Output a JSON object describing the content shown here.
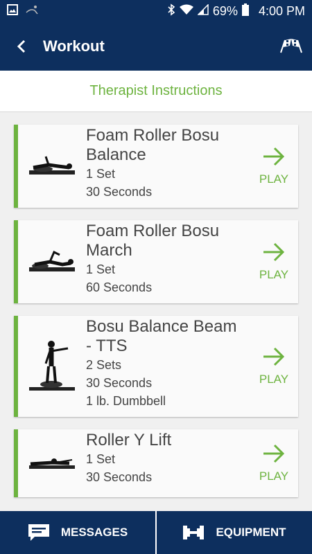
{
  "status_bar": {
    "battery": "69%",
    "time": "4:00 PM"
  },
  "app_bar": {
    "title": "Workout"
  },
  "instructions": {
    "label": "Therapist Instructions"
  },
  "exercises": [
    {
      "title_lines": [
        "Foam Roller Bosu",
        "Balance"
      ],
      "details": [
        "1 Set",
        "30 Seconds"
      ],
      "play_label": "PLAY"
    },
    {
      "title_lines": [
        "Foam Roller Bosu",
        "March"
      ],
      "details": [
        "1 Set",
        "60 Seconds"
      ],
      "play_label": "PLAY"
    },
    {
      "title_lines": [
        "Bosu Balance Beam",
        "- TTS"
      ],
      "details": [
        "2 Sets",
        "30 Seconds",
        "1 lb. Dumbbell"
      ],
      "play_label": "PLAY"
    },
    {
      "title_lines": [
        "Roller Y Lift"
      ],
      "details": [
        "1 Set",
        "30 Seconds"
      ],
      "play_label": "PLAY"
    }
  ],
  "bottom_nav": {
    "messages": "MESSAGES",
    "equipment": "EQUIPMENT"
  },
  "colors": {
    "primary": "#0d2f5e",
    "accent": "#6db33f"
  }
}
